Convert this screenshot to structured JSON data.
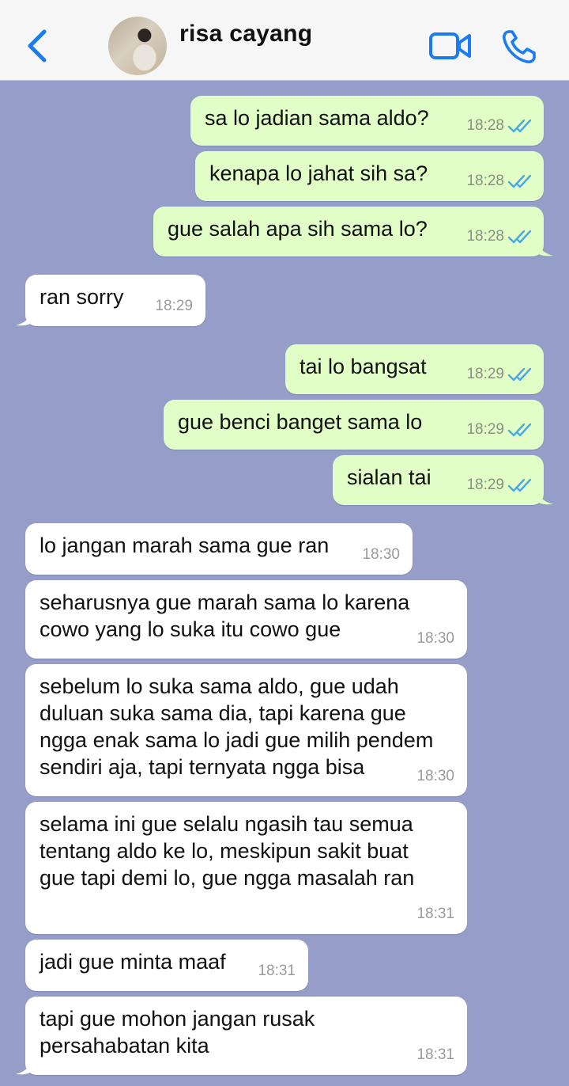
{
  "header": {
    "contact_name": "risa cayang",
    "back_icon": "chevron-left-icon",
    "video_icon": "video-camera-icon",
    "phone_icon": "phone-icon",
    "accent_color": "#1a7cf0"
  },
  "messages": [
    {
      "dir": "out",
      "text": "sa lo jadian sama aldo?",
      "time": "18:28",
      "status": "read"
    },
    {
      "dir": "out",
      "text": "kenapa lo jahat sih sa?",
      "time": "18:28",
      "status": "read"
    },
    {
      "dir": "out",
      "text": "gue salah apa sih sama lo?",
      "time": "18:28",
      "status": "read"
    },
    {
      "dir": "in",
      "text": "ran sorry",
      "time": "18:29"
    },
    {
      "dir": "out",
      "text": "tai lo bangsat",
      "time": "18:29",
      "status": "read"
    },
    {
      "dir": "out",
      "text": "gue benci banget sama lo",
      "time": "18:29",
      "status": "read"
    },
    {
      "dir": "out",
      "text": "sialan tai",
      "time": "18:29",
      "status": "read"
    },
    {
      "dir": "in",
      "text": "lo jangan marah sama gue ran",
      "time": "18:30"
    },
    {
      "dir": "in",
      "text": "seharusnya gue marah sama lo karena\ncowo yang lo suka itu cowo gue",
      "time": "18:30"
    },
    {
      "dir": "in",
      "text": "sebelum lo suka sama aldo, gue udah\nduluan suka sama dia, tapi karena gue\nngga enak sama lo jadi gue milih pendem\nsendiri aja, tapi ternyata ngga bisa",
      "time": "18:30"
    },
    {
      "dir": "in",
      "text": "selama ini gue selalu ngasih tau semua\ntentang aldo ke lo, meskipun sakit buat\ngue tapi demi lo, gue ngga masalah ran",
      "time": "18:31"
    },
    {
      "dir": "in",
      "text": "jadi gue minta maaf",
      "time": "18:31"
    },
    {
      "dir": "in",
      "text": "tapi gue mohon jangan rusak\npersahabatan kita",
      "time": "18:31"
    }
  ],
  "colors": {
    "chat_background": "#959dc8",
    "outgoing_bubble": "#e1fec6",
    "incoming_bubble": "#ffffff",
    "read_ticks": "#4aa8e8"
  }
}
